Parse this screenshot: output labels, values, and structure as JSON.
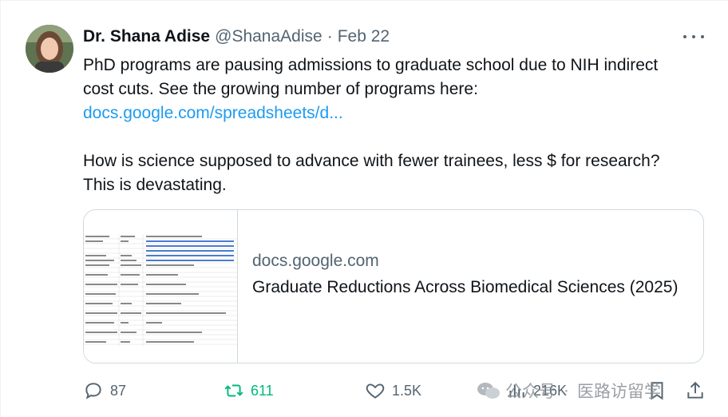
{
  "tweet": {
    "author": {
      "display_name": "Dr. Shana Adise",
      "handle": "@ShanaAdise",
      "separator": "·",
      "date": "Feb 22"
    },
    "text": {
      "line1": "PhD programs are pausing admissions to graduate school due to NIH indirect cost cuts. See the growing number of programs here:",
      "link": "docs.google.com/spreadsheets/d...",
      "line2": "How is science supposed to advance with fewer trainees, less $ for research? This is devastating."
    },
    "card": {
      "domain": "docs.google.com",
      "title": "Graduate Reductions Across Biomedical Sciences (2025)"
    },
    "actions": {
      "reply": {
        "icon": "reply-icon",
        "count": "87"
      },
      "retweet": {
        "icon": "retweet-icon",
        "count": "611",
        "color": "#00ba7c"
      },
      "like": {
        "icon": "heart-icon",
        "count": "1.5K"
      },
      "views": {
        "icon": "views-icon",
        "count": "216K"
      },
      "bookmark": {
        "icon": "bookmark-icon"
      },
      "share": {
        "icon": "share-icon"
      }
    },
    "watermark": {
      "left": "公众号",
      "sep": "·",
      "right": "医路访留学"
    }
  },
  "colors": {
    "link": "#1d9bf0",
    "muted": "#536471",
    "text": "#0f1419",
    "border": "#cfd9de",
    "retweet": "#00ba7c"
  }
}
